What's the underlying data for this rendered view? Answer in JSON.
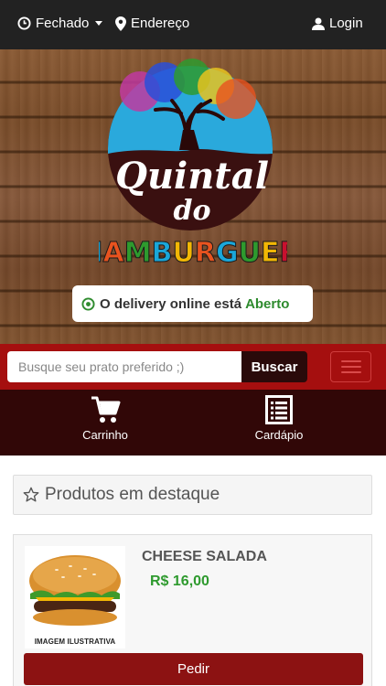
{
  "topbar": {
    "status_label": "Fechado",
    "address_label": "Endereço",
    "login_label": "Login"
  },
  "brand": {
    "name_line1": "Quintal",
    "name_line2": "do",
    "name_line3": "HAMBURGUER",
    "hamburguer_letter_colors": [
      "#1aa7d9",
      "#e8531f",
      "#2e9a2e",
      "#1aa7d9",
      "#f2b705",
      "#e8531f",
      "#1aa7d9",
      "#2e9a2e",
      "#f2b705",
      "#c8102e"
    ]
  },
  "delivery": {
    "prefix": "O delivery online está",
    "status": "Aberto"
  },
  "search": {
    "placeholder": "Busque seu prato preferido ;)",
    "button_label": "Buscar"
  },
  "nav": {
    "cart_label": "Carrinho",
    "menu_label": "Cardápio"
  },
  "featured": {
    "title": "Produtos em destaque"
  },
  "product": {
    "name": "CHEESE SALADA",
    "price": "R$ 16,00",
    "image_caption": "IMAGEM ILUSTRATIVA",
    "order_label": "Pedir"
  },
  "colors": {
    "topbar": "#222222",
    "search_band": "#a50f0f",
    "nav_strip": "#310707",
    "order_button": "#8c1212",
    "price_green": "#2e9a2e"
  },
  "icons": [
    "clock-icon",
    "map-marker-icon",
    "user-icon",
    "cart-icon",
    "list-icon",
    "star-icon",
    "hamburger-menu-icon",
    "check-circle-icon"
  ]
}
